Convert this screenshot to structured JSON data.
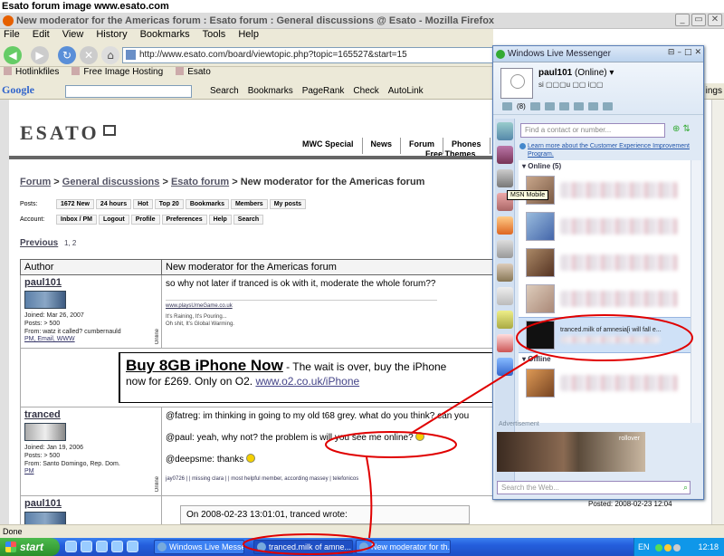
{
  "caption": "Esato forum image www.esato.com",
  "browser": {
    "title": "New moderator for the Americas forum : Esato forum : General discussions @ Esato - Mozilla Firefox",
    "menu": [
      "File",
      "Edit",
      "View",
      "History",
      "Bookmarks",
      "Tools",
      "Help"
    ],
    "url": "http://www.esato.com/board/viewtopic.php?topic=165527&start=15",
    "bookmarks": [
      "Hotlinkfiles",
      "Free Image Hosting",
      "Esato"
    ],
    "google_toolbar": {
      "logo": "Google",
      "items": [
        "Search",
        "Bookmarks",
        "PageRank",
        "Check",
        "AutoLink"
      ],
      "tail": "ings"
    },
    "status": "Done"
  },
  "site": {
    "logo": "ESATO",
    "nav": [
      "MWC Special",
      "News",
      "Forum",
      "Phones"
    ],
    "free_themes": "Free Themes",
    "breadcrumb": {
      "forum": "Forum",
      "sep": ">",
      "general": "General discussions",
      "esato_forum": "Esato forum",
      "current": "New moderator for the Americas forum"
    },
    "posts_row": {
      "label": "Posts:",
      "cells": [
        "1672 New",
        "24 hours",
        "Hot",
        "Top 20",
        "Bookmarks",
        "Members",
        "My posts"
      ]
    },
    "account_row": {
      "label": "Account:",
      "cells": [
        "Inbox / PM",
        "Logout",
        "Profile",
        "Preferences",
        "Help",
        "Search"
      ]
    },
    "pager": {
      "label": "Previous",
      "pages": "1, 2"
    },
    "table_head": {
      "author": "Author",
      "topic": "New moderator for the Americas forum"
    }
  },
  "posts": [
    {
      "user": "paul101",
      "joined": "Joined: Mar 26, 2007",
      "posts": "Posts: > 500",
      "from": "From: watz it called? cumbernauld",
      "links": "PM, Email, WWW",
      "online": "Online",
      "text": "so why not later if tranced is ok with it, moderate the whole forum??",
      "sig_link": "www.playsUrneGame.co.uk",
      "sig1": "It's Raining, It's Pouring...",
      "sig2": "Oh shit, It's Global Warming."
    },
    {
      "user": "tranced",
      "joined": "Joined: Jan 19, 2006",
      "posts": "Posts: > 500",
      "from": "From: Santo Domingo, Rep. Dom.",
      "links": "PM",
      "online": "Online",
      "line1": "@fatreg: im thinking in going to my old t68 grey. what do you think? can you",
      "line2a": "@paul: yeah, why not? the problem is",
      "line2b": "will you see me online?",
      "line3": "@deepsme: thanks",
      "sig": "jay0726 | | missing clara | | most helpful member, according massey | telefonicos"
    },
    {
      "user": "paul101",
      "quote": "On 2008-02-23 13:01:01, tranced wrote:",
      "posted": "Posted: 2008-02-23 12:04"
    }
  ],
  "ad": {
    "headline": "Buy 8GB iPhone Now",
    "rest": " - The wait is over, buy the iPhone",
    "line2": "now for £269. Only on O2.",
    "link": "www.o2.co.uk/iPhone"
  },
  "messenger": {
    "title": "Windows Live Messenger",
    "user": "paul101",
    "status": "(Online)",
    "personal_message": "si ▢▢▢u ▢▢ i▢▢",
    "counter": "(8)",
    "search_placeholder": "Find a contact or number...",
    "learn": "Learn more about the Customer Experience Improvement Program.",
    "group_online": "Online (5)",
    "group_offline": "Offline",
    "selected_contact": "tranced.milk of amnesia[i will fall e...",
    "tooltip": "MSN Mobile",
    "ad_label": "Advertisement",
    "ad_rollover": "rollover",
    "web_placeholder": "Search the Web..."
  },
  "taskbar": {
    "start": "start",
    "tasks": [
      "Windows Live Messen...",
      "tranced.milk of amne...",
      "New moderator for th..."
    ],
    "lang": "EN",
    "clock": "12:18"
  },
  "colors": {
    "annotation": "#e00000",
    "taskbar": "#245edc",
    "messenger_border": "#5a7fb8"
  }
}
